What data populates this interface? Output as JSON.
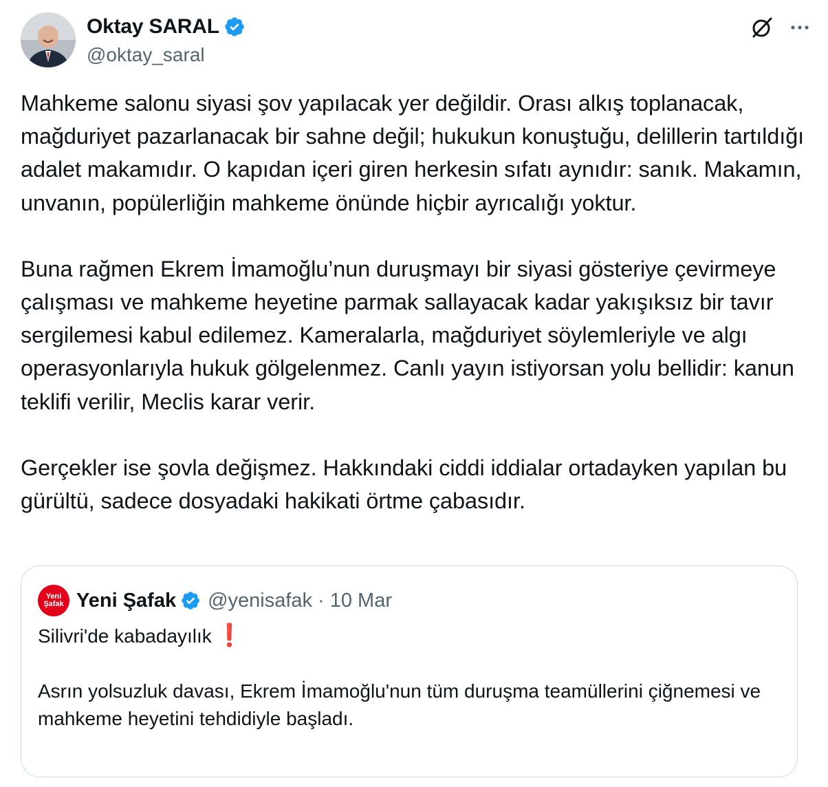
{
  "author": {
    "display_name": "Oktay SARAL",
    "handle": "@oktay_saral",
    "verified": true
  },
  "icons": {
    "verified": "verified-badge-icon",
    "grok": "grok-icon",
    "more": "more-options-icon",
    "accent_color": "#1d9bf0"
  },
  "tweet": {
    "paragraphs": [
      "Mahkeme salonu siyasi şov yapılacak yer değildir. Orası alkış toplanacak, mağduriyet pazarlanacak bir sahne değil; hukukun konuştuğu, delillerin tartıldığı adalet makamıdır. O kapıdan içeri giren herkesin sıfatı aynıdır: sanık. Makamın, unvanın, popülerliğin mahkeme önünde hiçbir ayrıcalığı yoktur.",
      "Buna rağmen Ekrem İmamoğlu’nun duruşmayı bir siyasi gösteriye çevirmeye çalışması ve mahkeme heyetine parmak sallayacak kadar yakışıksız bir tavır sergilemesi kabul edilemez. Kameralarla, mağduriyet söylemleriyle ve algı operasyonlarıyla hukuk gölgelenmez. Canlı yayın istiyorsan yolu bellidir: kanun teklifi verilir, Meclis karar verir.",
      "Gerçekler ise şovla değişmez. Hakkındaki ciddi iddialar ortadayken yapılan bu gürültü, sadece dosyadaki hakikati örtme çabasıdır."
    ]
  },
  "quoted_tweet": {
    "logo_line1": "Yeni",
    "logo_line2": "Şafak",
    "display_name": "Yeni Şafak",
    "handle": "@yenisafak",
    "separator": "·",
    "date": "10 Mar",
    "line1": "Silivri'de kabadayılık",
    "emoji": "❗",
    "line2": "Asrın yolsuzluk davası, Ekrem İmamoğlu'nun tüm duruşma teamüllerini çiğnemesi ve mahkeme heyetini tehdidiyle başladı.",
    "brand_color": "#e3001b"
  }
}
